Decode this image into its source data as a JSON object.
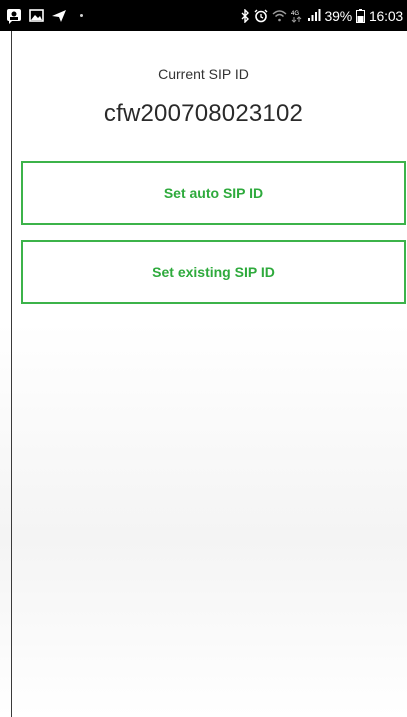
{
  "status_bar": {
    "left_icons": [
      "photo-message-icon",
      "gallery-icon",
      "send-icon"
    ],
    "right_icons": [
      "bluetooth-icon",
      "alarm-icon",
      "wifi-icon",
      "4g-icon",
      "signal-icon",
      "battery-icon"
    ],
    "battery_percent": "39%",
    "time": "16:03",
    "network": "4G"
  },
  "main": {
    "caption": "Current SIP ID",
    "sip_id": "cfw200708023102"
  },
  "buttons": {
    "auto": "Set auto SIP ID",
    "existing": "Set existing SIP ID"
  },
  "colors": {
    "accent": "#3cb34a",
    "status_bar_bg": "#000000"
  }
}
